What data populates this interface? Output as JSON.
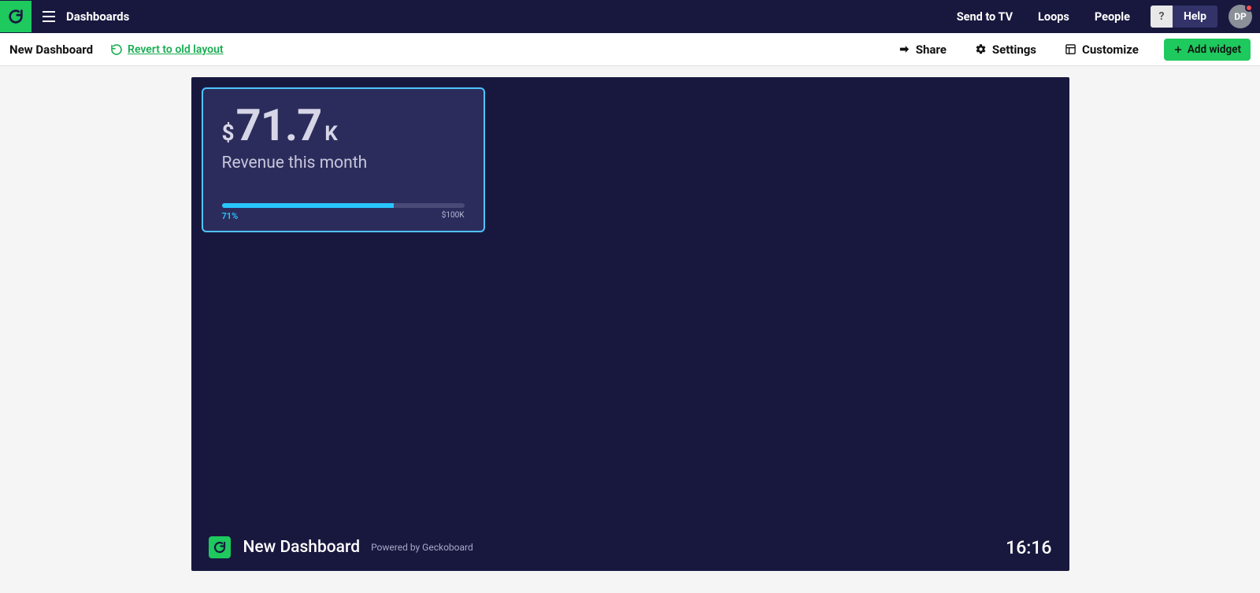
{
  "topnav": {
    "crumb": "Dashboards",
    "links": [
      "Send to TV",
      "Loops",
      "People"
    ],
    "help_q": "?",
    "help_label": "Help",
    "avatar_initials": "DP"
  },
  "toolbar": {
    "dashboard_title": "New Dashboard",
    "revert_label": "Revert to old layout",
    "share_label": "Share",
    "settings_label": "Settings",
    "customize_label": "Customize",
    "add_widget_label": "Add widget"
  },
  "widget": {
    "currency": "$",
    "value": "71.7",
    "suffix": "K",
    "label": "Revenue this month",
    "progress_percent": 71,
    "progress_label": "71%",
    "goal_label": "$100K"
  },
  "footer": {
    "dashboard_title": "New Dashboard",
    "powered_by": "Powered by Geckoboard",
    "clock": "16:16"
  }
}
